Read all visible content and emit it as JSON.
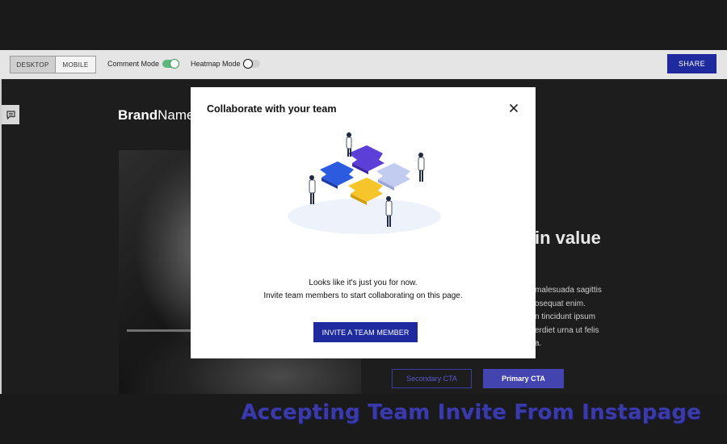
{
  "toolbar": {
    "view_modes": [
      "DESKTOP",
      "MOBILE"
    ],
    "selected_view": "DESKTOP",
    "comment_mode_label": "Comment Mode",
    "comment_mode_on": true,
    "heatmap_mode_label": "Heatmap Mode",
    "heatmap_mode_on": false,
    "share_label": "SHARE"
  },
  "page": {
    "brand_bold": "Brand",
    "brand_rest": "Name",
    "headline_visible": "in value",
    "body_lines": [
      "malesuada sagittis",
      "osequat enim.",
      "n tincidunt ipsum",
      "erdiet urna ut felis",
      "a."
    ],
    "secondary_cta": "Secondary CTA",
    "primary_cta": "Primary CTA"
  },
  "modal": {
    "title": "Collaborate with your team",
    "close_icon": "close-icon",
    "illustration": "team-puzzle-illustration",
    "line1": "Looks like it's just you for now.",
    "line2": "Invite team members to start collaborating on this page.",
    "invite_button": "INVITE A TEAM MEMBER"
  },
  "caption": "Accepting Team Invite From Instapage",
  "colors": {
    "accent": "#1e2a9e",
    "toggle_on": "#5cb87c",
    "caption": "#3b3ba8"
  }
}
